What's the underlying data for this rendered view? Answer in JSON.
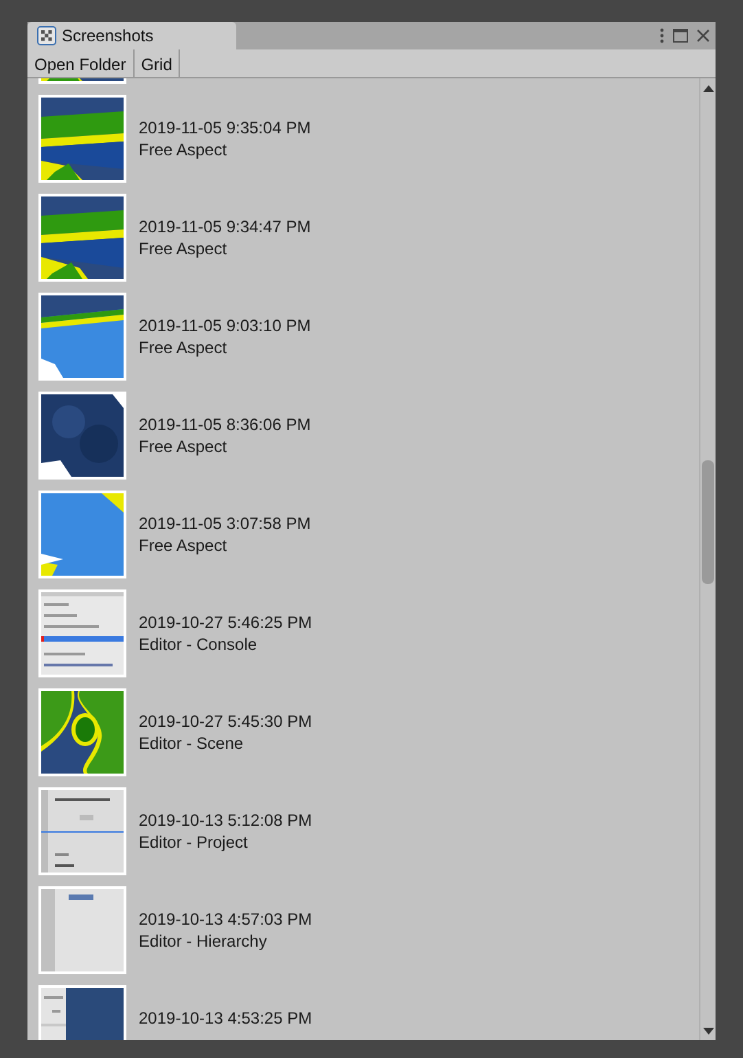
{
  "window": {
    "title": "Screenshots",
    "selected": true
  },
  "toolbar": {
    "buttons": [
      "Open Folder",
      "Grid"
    ]
  },
  "rows": [
    {
      "kind": "picture"
    },
    {
      "kind": "picture",
      "date": "2019-11-05 9:35:04 PM",
      "label": "Free Aspect"
    },
    {
      "kind": "picture",
      "date": "2019-11-05 9:34:47 PM",
      "label": "Free Aspect"
    },
    {
      "kind": "picture",
      "date": "2019-11-05 9:03:10 PM",
      "label": "Free Aspect"
    },
    {
      "kind": "picture",
      "date": "2019-11-05 8:36:06 PM",
      "label": "Free Aspect"
    },
    {
      "kind": "picture",
      "date": "2019-11-05 3:07:58 PM",
      "label": "Free Aspect"
    },
    {
      "kind": "picture",
      "date": "2019-10-27 5:46:25 PM",
      "label": "Editor - Console"
    },
    {
      "kind": "picture",
      "date": "2019-10-27 5:45:30 PM",
      "label": "Editor - Scene"
    },
    {
      "kind": "picture",
      "date": "2019-10-13 5:12:08 PM",
      "label": "Editor - Project"
    },
    {
      "kind": "picture",
      "date": "2019-10-13 4:57:03 PM",
      "label": "Editor - Hierarchy"
    },
    {
      "kind": "picture",
      "date": "2019-10-13 4:53:25 PM"
    }
  ]
}
